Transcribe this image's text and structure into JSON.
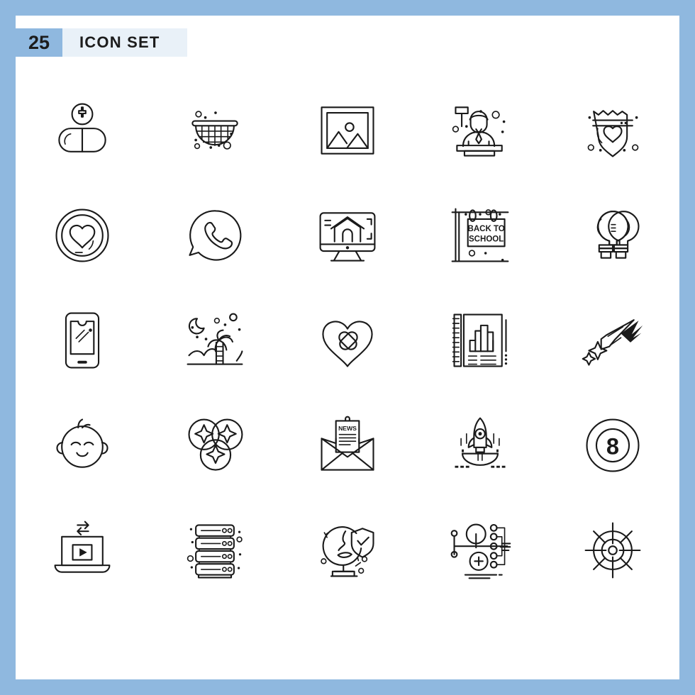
{
  "header": {
    "count": "25",
    "title": "ICON SET"
  },
  "colors": {
    "page_background": "#8fb8df",
    "sheet_background": "#ffffff",
    "header_background": "#e9f1f8",
    "count_badge_background": "#8fb8df",
    "icon_stroke": "#1a1a1a",
    "text": "#1c1c1c"
  },
  "grid": {
    "columns": 5,
    "rows": 5,
    "total_icons": 25
  },
  "icons": [
    {
      "index": 1,
      "name": "pill-capsule-medical-icon",
      "label": "Capsule pill with medical cross"
    },
    {
      "index": 2,
      "name": "strainer-sieve-icon",
      "label": "Strainer / colander"
    },
    {
      "index": 3,
      "name": "image-picture-frame-icon",
      "label": "Picture frame with mountains"
    },
    {
      "index": 4,
      "name": "judge-gavel-icon",
      "label": "Judge with gavel at bench"
    },
    {
      "index": 5,
      "name": "police-badge-heart-icon",
      "label": "Police badge with heart"
    },
    {
      "index": 6,
      "name": "heart-circle-icon",
      "label": "Heart inside circle"
    },
    {
      "index": 7,
      "name": "whatsapp-phone-chat-icon",
      "label": "Phone in speech bubble"
    },
    {
      "index": 8,
      "name": "monitor-house-website-icon",
      "label": "Monitor showing a house"
    },
    {
      "index": 9,
      "name": "back-to-school-banner-icon",
      "label": "Back to School banner"
    },
    {
      "index": 10,
      "name": "two-light-bulbs-idea-icon",
      "label": "Two light bulbs"
    },
    {
      "index": 11,
      "name": "smartphone-mobile-icon",
      "label": "Smartphone"
    },
    {
      "index": 12,
      "name": "palm-tree-night-beach-icon",
      "label": "Palm tree with moon and stars"
    },
    {
      "index": 13,
      "name": "heart-bandage-healing-icon",
      "label": "Heart with crossed bandages"
    },
    {
      "index": 14,
      "name": "report-notebook-chart-icon",
      "label": "Spiral report with bar chart"
    },
    {
      "index": 15,
      "name": "shooting-star-comet-icon",
      "label": "Shooting star with sparkles"
    },
    {
      "index": 16,
      "name": "baby-face-icon",
      "label": "Smiling baby face"
    },
    {
      "index": 17,
      "name": "bubbles-sparkle-icon",
      "label": "Three bubbles with sparkles"
    },
    {
      "index": 18,
      "name": "newsletter-envelope-icon",
      "label": "Envelope with NEWS letter"
    },
    {
      "index": 19,
      "name": "rocket-launch-bowl-icon",
      "label": "Rocket launching from bowl"
    },
    {
      "index": 20,
      "name": "eight-ball-billiard-icon",
      "label": "Eight ball"
    },
    {
      "index": 21,
      "name": "laptop-video-transfer-icon",
      "label": "Laptop with play button and transfer arrows"
    },
    {
      "index": 22,
      "name": "server-stack-database-icon",
      "label": "Server rack stack"
    },
    {
      "index": 23,
      "name": "globe-shield-security-icon",
      "label": "Globe with shield checkmark"
    },
    {
      "index": 24,
      "name": "network-nodes-add-icon",
      "label": "Network nodes with add button"
    },
    {
      "index": 25,
      "name": "target-crosshair-wheel-icon",
      "label": "Target crosshair wheel"
    }
  ],
  "icon_text": {
    "news_label": "NEWS",
    "back_to_school_line1": "BACK TO",
    "back_to_school_line2": "SCHOOL",
    "eight_ball_number": "8"
  }
}
